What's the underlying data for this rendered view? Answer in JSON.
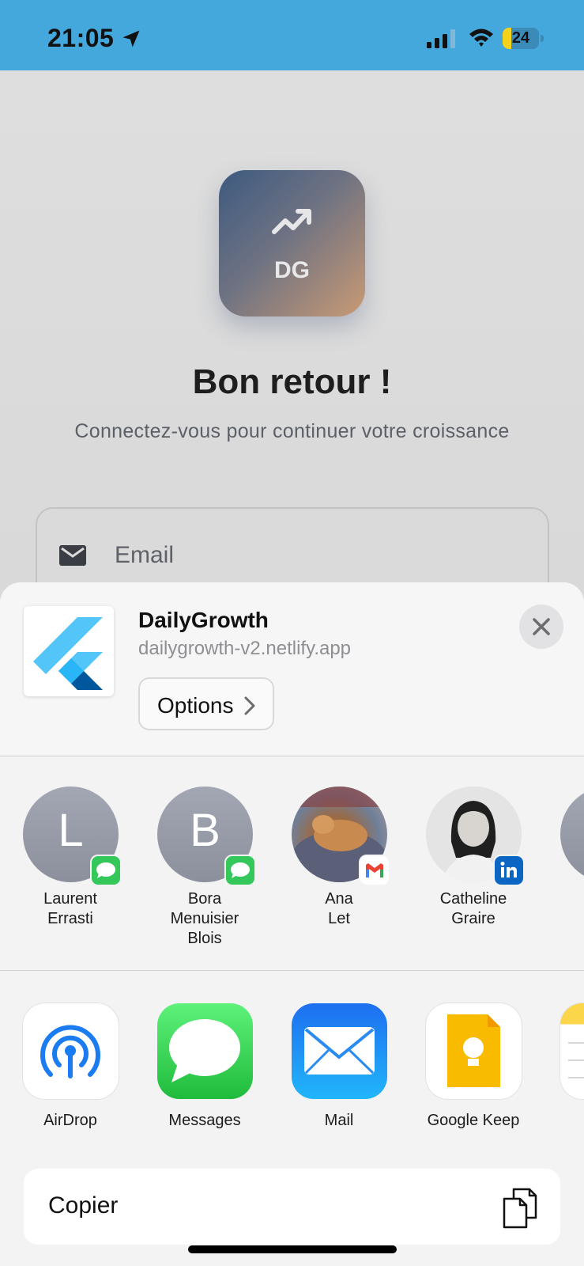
{
  "status_bar": {
    "time": "21:05",
    "battery": "24",
    "battery_percent": 24
  },
  "login": {
    "logo_text": "DG",
    "title": "Bon retour !",
    "subtitle": "Connectez-vous pour continuer votre croissance",
    "email_placeholder": "Email"
  },
  "share_sheet": {
    "app_name": "DailyGrowth",
    "app_url": "dailygrowth-v2.netlify.app",
    "options_label": "Options",
    "contacts": [
      {
        "initial": "L",
        "name_line1": "Laurent",
        "name_line2": "Errasti",
        "name_line3": "",
        "badge": "messages-icon"
      },
      {
        "initial": "B",
        "name_line1": "Bora",
        "name_line2": "Menuisier",
        "name_line3": "Blois",
        "badge": "messages-icon"
      },
      {
        "initial": "",
        "name_line1": "Ana",
        "name_line2": "Let",
        "name_line3": "",
        "badge": "gmail-icon"
      },
      {
        "initial": "",
        "name_line1": "Catheline",
        "name_line2": "Graire",
        "name_line3": "",
        "badge": "linkedin-icon"
      }
    ],
    "apps": [
      {
        "label": "AirDrop",
        "icon": "airdrop-icon"
      },
      {
        "label": "Messages",
        "icon": "messages-icon"
      },
      {
        "label": "Mail",
        "icon": "mail-icon"
      },
      {
        "label": "Google Keep",
        "icon": "google-keep-icon"
      }
    ],
    "copy_label": "Copier"
  },
  "colors": {
    "status_bar": "#45a8dc",
    "messages_green": "#34c759",
    "mail_blue": "#1a8cf5",
    "keep_yellow": "#f9bb00",
    "linkedin_blue": "#0a66c2"
  }
}
